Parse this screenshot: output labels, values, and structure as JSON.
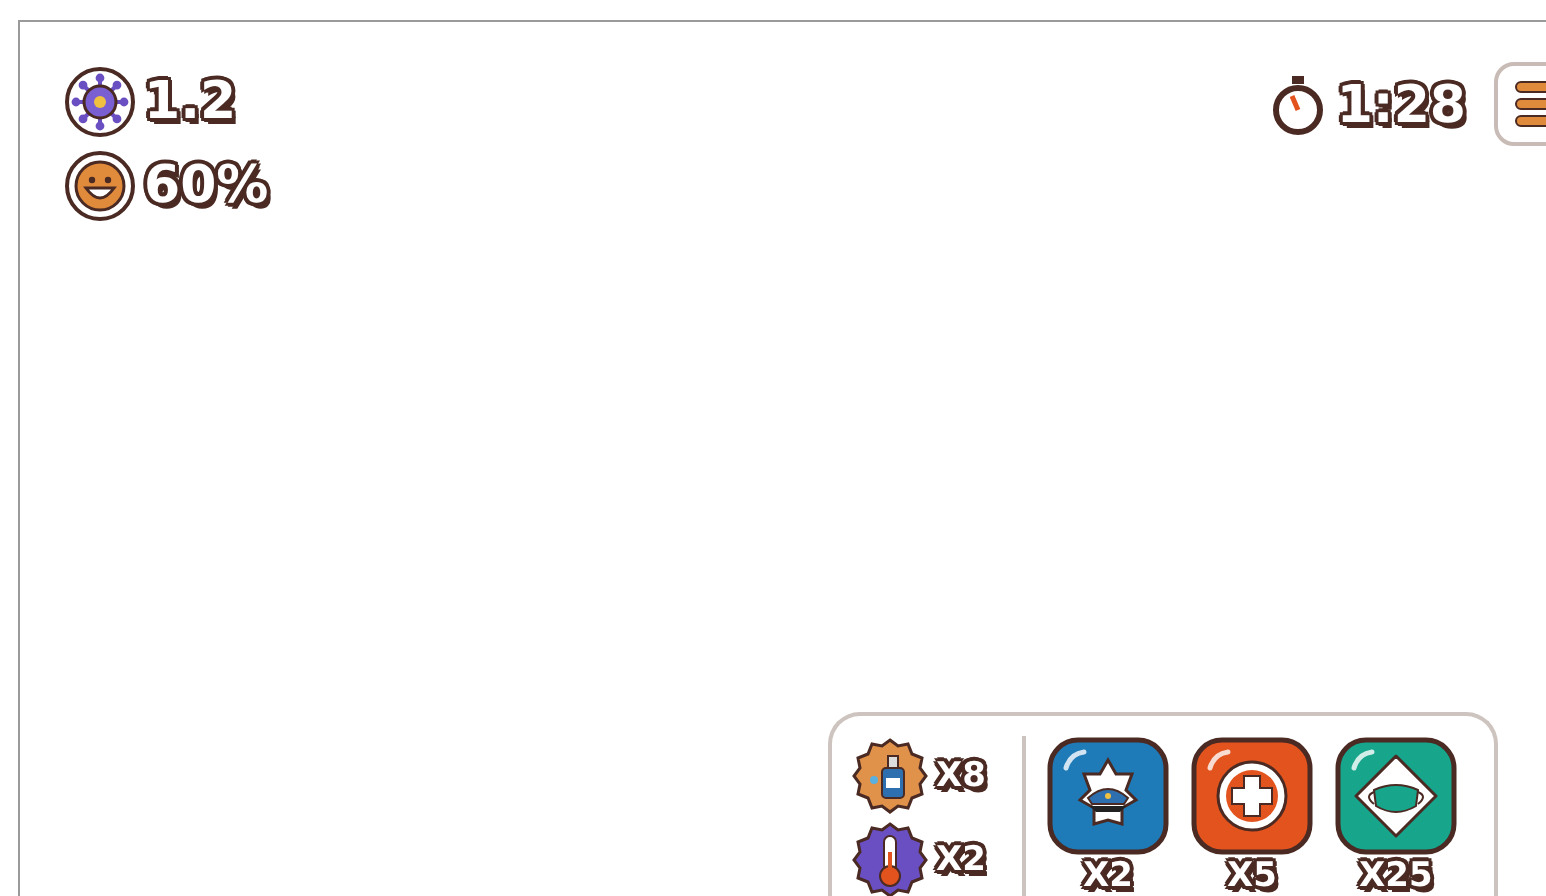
{
  "stats": [
    {
      "kind": "infection",
      "value": "1.2"
    },
    {
      "kind": "happiness",
      "value": "60%"
    }
  ],
  "timer": "1:28",
  "supplies": [
    {
      "kind": "sanitizer",
      "count": "X8",
      "color": "#e0914a"
    },
    {
      "kind": "thermometer",
      "count": "X2",
      "color": "#6a4fc2"
    }
  ],
  "units": [
    {
      "kind": "police",
      "count": "X2",
      "color": "#1f7ab8"
    },
    {
      "kind": "medic",
      "count": "X5",
      "color": "#e2531d"
    },
    {
      "kind": "mask",
      "count": "X25",
      "color": "#17a58c"
    }
  ]
}
